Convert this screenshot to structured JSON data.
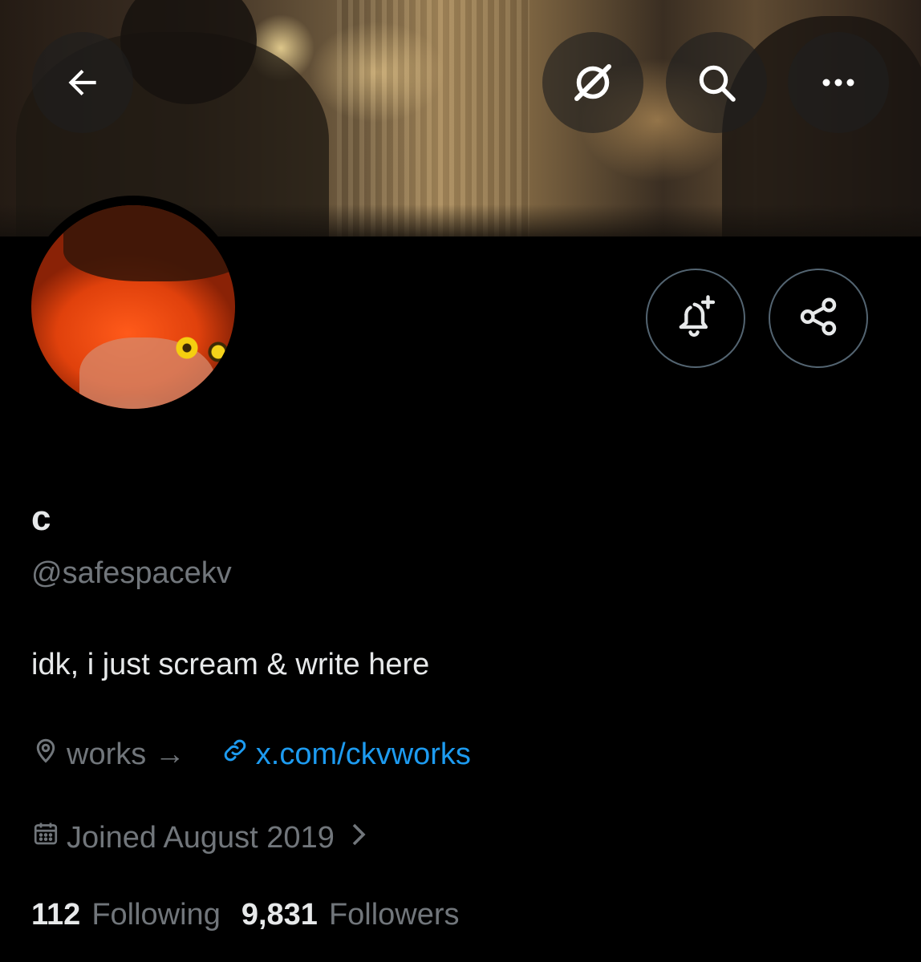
{
  "header": {
    "back_icon": "arrow-left-icon",
    "grok_icon": "grok-icon",
    "search_icon": "search-icon",
    "more_icon": "more-horizontal-icon"
  },
  "profile": {
    "display_name": "c",
    "handle": "@safespacekv",
    "bio": "idk, i just scream & write here",
    "location": "works →",
    "website": "x.com/ckvworks",
    "joined": "Joined August 2019",
    "following_count": "112",
    "following_label": "Following",
    "followers_count": "9,831",
    "followers_label": "Followers"
  },
  "actions": {
    "notify_icon": "bell-plus-icon",
    "share_icon": "share-icon"
  },
  "colors": {
    "background": "#000000",
    "primary_text": "#e7e9ea",
    "secondary_text": "#71767b",
    "link": "#1d9bf0",
    "border": "#536471"
  }
}
